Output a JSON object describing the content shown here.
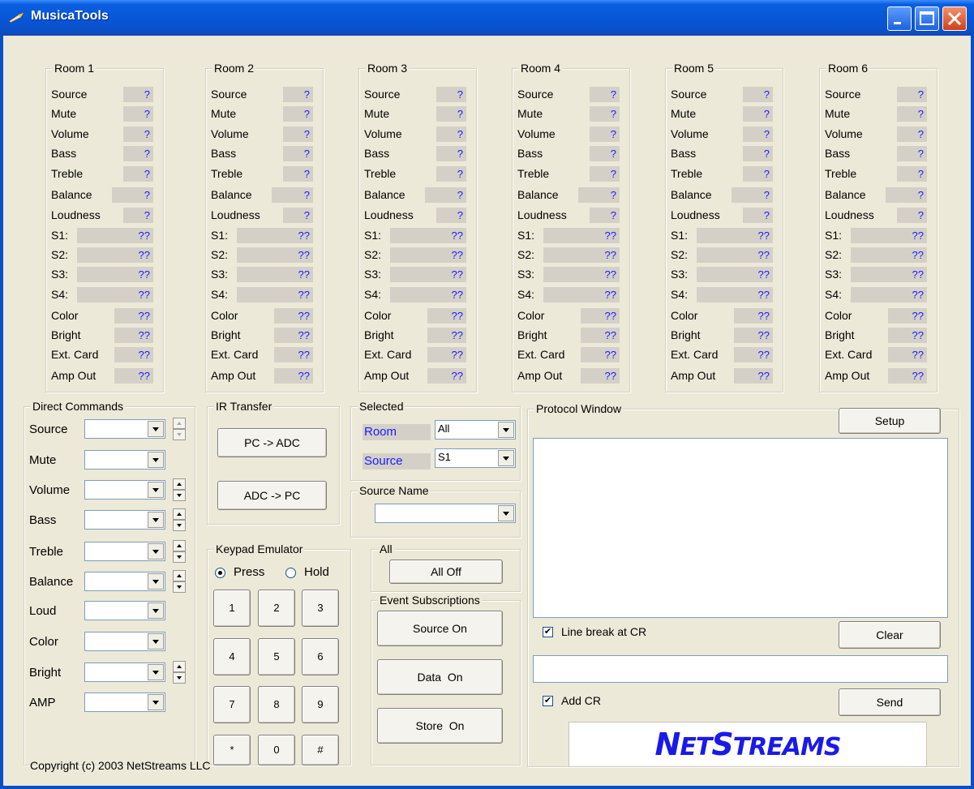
{
  "window": {
    "title": "MusicaTools"
  },
  "rooms": [
    {
      "title": "Room 1",
      "rows": [
        {
          "label": "Source",
          "value": "?"
        },
        {
          "label": "Mute",
          "value": "?"
        },
        {
          "label": "Volume",
          "value": "?"
        },
        {
          "label": "Bass",
          "value": "?"
        },
        {
          "label": "Treble",
          "value": "?"
        },
        {
          "label": "Balance",
          "value": "?"
        },
        {
          "label": "Loudness",
          "value": "?"
        },
        {
          "label": "S1:",
          "value": "??"
        },
        {
          "label": "S2:",
          "value": "??"
        },
        {
          "label": "S3:",
          "value": "??"
        },
        {
          "label": "S4:",
          "value": "??"
        },
        {
          "label": "Color",
          "value": "??"
        },
        {
          "label": "Bright",
          "value": "??"
        },
        {
          "label": "Ext. Card",
          "value": "??"
        },
        {
          "label": "Amp Out",
          "value": "??"
        }
      ]
    },
    {
      "title": "Room 2",
      "rows": [
        {
          "label": "Source",
          "value": "?"
        },
        {
          "label": "Mute",
          "value": "?"
        },
        {
          "label": "Volume",
          "value": "?"
        },
        {
          "label": "Bass",
          "value": "?"
        },
        {
          "label": "Treble",
          "value": "?"
        },
        {
          "label": "Balance",
          "value": "?"
        },
        {
          "label": "Loudness",
          "value": "?"
        },
        {
          "label": "S1:",
          "value": "??"
        },
        {
          "label": "S2:",
          "value": "??"
        },
        {
          "label": "S3:",
          "value": "??"
        },
        {
          "label": "S4:",
          "value": "??"
        },
        {
          "label": "Color",
          "value": "??"
        },
        {
          "label": "Bright",
          "value": "??"
        },
        {
          "label": "Ext. Card",
          "value": "??"
        },
        {
          "label": "Amp Out",
          "value": "??"
        }
      ]
    },
    {
      "title": "Room 3",
      "rows": [
        {
          "label": "Source",
          "value": "?"
        },
        {
          "label": "Mute",
          "value": "?"
        },
        {
          "label": "Volume",
          "value": "?"
        },
        {
          "label": "Bass",
          "value": "?"
        },
        {
          "label": "Treble",
          "value": "?"
        },
        {
          "label": "Balance",
          "value": "?"
        },
        {
          "label": "Loudness",
          "value": "?"
        },
        {
          "label": "S1:",
          "value": "??"
        },
        {
          "label": "S2:",
          "value": "??"
        },
        {
          "label": "S3:",
          "value": "??"
        },
        {
          "label": "S4:",
          "value": "??"
        },
        {
          "label": "Color",
          "value": "??"
        },
        {
          "label": "Bright",
          "value": "??"
        },
        {
          "label": "Ext. Card",
          "value": "??"
        },
        {
          "label": "Amp Out",
          "value": "??"
        }
      ]
    },
    {
      "title": "Room 4",
      "rows": [
        {
          "label": "Source",
          "value": "?"
        },
        {
          "label": "Mute",
          "value": "?"
        },
        {
          "label": "Volume",
          "value": "?"
        },
        {
          "label": "Bass",
          "value": "?"
        },
        {
          "label": "Treble",
          "value": "?"
        },
        {
          "label": "Balance",
          "value": "?"
        },
        {
          "label": "Loudness",
          "value": "?"
        },
        {
          "label": "S1:",
          "value": "??"
        },
        {
          "label": "S2:",
          "value": "??"
        },
        {
          "label": "S3:",
          "value": "??"
        },
        {
          "label": "S4:",
          "value": "??"
        },
        {
          "label": "Color",
          "value": "??"
        },
        {
          "label": "Bright",
          "value": "??"
        },
        {
          "label": "Ext. Card",
          "value": "??"
        },
        {
          "label": "Amp Out",
          "value": "??"
        }
      ]
    },
    {
      "title": "Room 5",
      "rows": [
        {
          "label": "Source",
          "value": "?"
        },
        {
          "label": "Mute",
          "value": "?"
        },
        {
          "label": "Volume",
          "value": "?"
        },
        {
          "label": "Bass",
          "value": "?"
        },
        {
          "label": "Treble",
          "value": "?"
        },
        {
          "label": "Balance",
          "value": "?"
        },
        {
          "label": "Loudness",
          "value": "?"
        },
        {
          "label": "S1:",
          "value": "??"
        },
        {
          "label": "S2:",
          "value": "??"
        },
        {
          "label": "S3:",
          "value": "??"
        },
        {
          "label": "S4:",
          "value": "??"
        },
        {
          "label": "Color",
          "value": "??"
        },
        {
          "label": "Bright",
          "value": "??"
        },
        {
          "label": "Ext. Card",
          "value": "??"
        },
        {
          "label": "Amp Out",
          "value": "??"
        }
      ]
    },
    {
      "title": "Room 6",
      "rows": [
        {
          "label": "Source",
          "value": "?"
        },
        {
          "label": "Mute",
          "value": "?"
        },
        {
          "label": "Volume",
          "value": "?"
        },
        {
          "label": "Bass",
          "value": "?"
        },
        {
          "label": "Treble",
          "value": "?"
        },
        {
          "label": "Balance",
          "value": "?"
        },
        {
          "label": "Loudness",
          "value": "?"
        },
        {
          "label": "S1:",
          "value": "??"
        },
        {
          "label": "S2:",
          "value": "??"
        },
        {
          "label": "S3:",
          "value": "??"
        },
        {
          "label": "S4:",
          "value": "??"
        },
        {
          "label": "Color",
          "value": "??"
        },
        {
          "label": "Bright",
          "value": "??"
        },
        {
          "label": "Ext. Card",
          "value": "??"
        },
        {
          "label": "Amp Out",
          "value": "??"
        }
      ]
    }
  ],
  "direct_commands": {
    "title": "Direct Commands",
    "items": [
      {
        "label": "Source",
        "spinner": "disabled"
      },
      {
        "label": "Mute",
        "spinner": "none"
      },
      {
        "label": "Volume",
        "spinner": "enabled"
      },
      {
        "label": "Bass",
        "spinner": "enabled"
      },
      {
        "label": "Treble",
        "spinner": "enabled"
      },
      {
        "label": "Balance",
        "spinner": "enabled"
      },
      {
        "label": "Loud",
        "spinner": "none"
      },
      {
        "label": "Color",
        "spinner": "none"
      },
      {
        "label": "Bright",
        "spinner": "enabled"
      },
      {
        "label": "AMP",
        "spinner": "none"
      }
    ]
  },
  "ir_transfer": {
    "title": "IR Transfer",
    "pc_to_adc": "PC -> ADC",
    "adc_to_pc": "ADC -> PC"
  },
  "keypad": {
    "title": "Keypad Emulator",
    "press_label": "Press",
    "hold_label": "Hold",
    "mode": "Press",
    "keys": [
      "1",
      "2",
      "3",
      "4",
      "5",
      "6",
      "7",
      "8",
      "9",
      "*",
      "0",
      "#"
    ]
  },
  "selected": {
    "title": "Selected",
    "room_label": "Room",
    "room_value": "All",
    "source_label": "Source",
    "source_value": "S1"
  },
  "source_name": {
    "title": "Source Name",
    "value": ""
  },
  "all": {
    "title": "All",
    "all_off": "All Off"
  },
  "event_subscriptions": {
    "title": "Event Subscriptions",
    "source_on": "Source On",
    "data_on": "Data  On",
    "store_on": "Store  On"
  },
  "protocol": {
    "title": "Protocol Window",
    "setup": "Setup",
    "log": "",
    "line_break_label": "Line break at CR",
    "line_break_checked": true,
    "clear": "Clear",
    "command_input": "",
    "add_cr_label": "Add CR",
    "add_cr_checked": true,
    "send": "Send"
  },
  "logo": {
    "text": "NETSTREAMS",
    "color": "#1a1ae8"
  },
  "footer": {
    "copyright": "Copyright (c) 2003 NetStreams LLC"
  }
}
